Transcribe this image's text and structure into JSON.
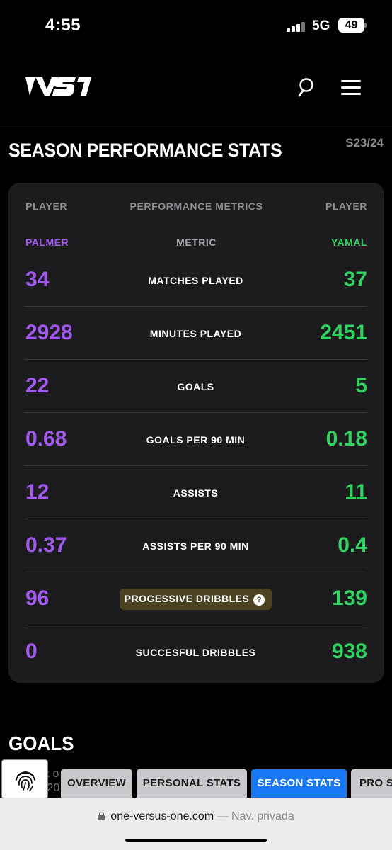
{
  "status_bar": {
    "time": "4:55",
    "network": "5G",
    "battery": "49"
  },
  "header": {
    "logo_text": "1VS1",
    "icons": [
      "search-icon",
      "hamburger-menu-icon"
    ]
  },
  "section": {
    "title": "SEASON PERFORMANCE STATS",
    "season": "S23/24"
  },
  "stats_table": {
    "headers": {
      "left": "PLAYER",
      "center": "PERFORMANCE METRICS",
      "right": "PLAYER"
    },
    "subheaders": {
      "left_player": "PALMER",
      "metric": "METRIC",
      "right_player": "YAMAL"
    },
    "colors": {
      "left_player": "#a259f0",
      "right_player": "#31d463",
      "highlight_pill": "#4a4221"
    },
    "rows": [
      {
        "left": "34",
        "metric": "MATCHES PLAYED",
        "right": "37"
      },
      {
        "left": "2928",
        "metric": "MINUTES PLAYED",
        "right": "2451"
      },
      {
        "left": "22",
        "metric": "GOALS",
        "right": "5"
      },
      {
        "left": "0.68",
        "metric": "GOALS PER 90 MIN",
        "right": "0.18"
      },
      {
        "left": "12",
        "metric": "ASSISTS",
        "right": "11"
      },
      {
        "left": "0.37",
        "metric": "ASSISTS PER 90 MIN",
        "right": "0.4"
      },
      {
        "left": "96",
        "metric": "PROGESSIVE DRIBBLES",
        "right": "139",
        "help": "?"
      },
      {
        "left": "0",
        "metric": "SUCCESFUL DRIBBLES",
        "right": "938"
      }
    ]
  },
  "goals_section": {
    "title": "GOALS"
  },
  "partial_text": {
    "line1": "k o",
    "line2": "/20"
  },
  "tabs": [
    {
      "label": "OVERVIEW",
      "active": false
    },
    {
      "label": "PERSONAL STATS",
      "active": false
    },
    {
      "label": "SEASON STATS",
      "active": true
    },
    {
      "label": "PRO S",
      "active": false
    }
  ],
  "browser": {
    "domain": "one-versus-one.com",
    "separator": "—",
    "mode": "Nav. privada"
  }
}
